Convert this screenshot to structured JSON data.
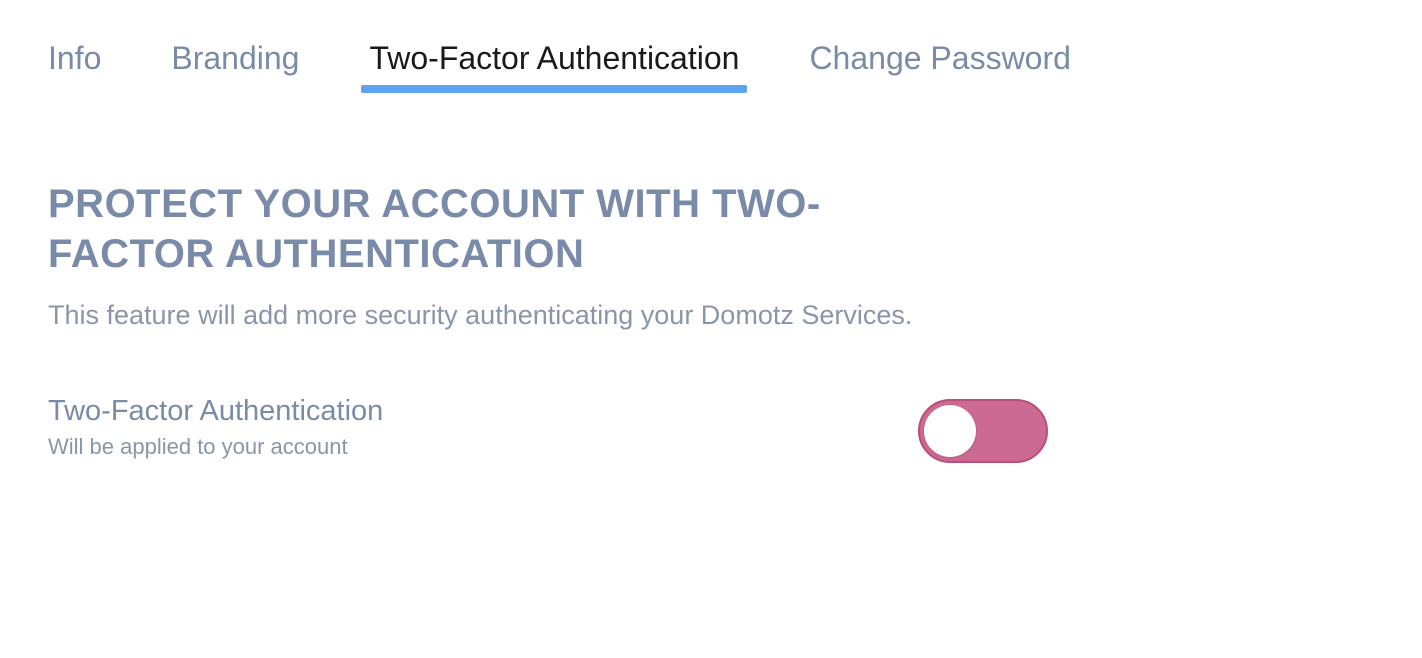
{
  "tabs": [
    {
      "label": "Info",
      "active": false
    },
    {
      "label": "Branding",
      "active": false
    },
    {
      "label": "Two-Factor Authentication",
      "active": true
    },
    {
      "label": "Change Password",
      "active": false
    }
  ],
  "section": {
    "title": "PROTECT YOUR ACCOUNT WITH TWO-FACTOR AUTHENTICATION",
    "description": "This feature will add more security authenticating your Domotz Services."
  },
  "setting": {
    "label": "Two-Factor Authentication",
    "sub": "Will be applied to your account",
    "toggle_on": false
  }
}
